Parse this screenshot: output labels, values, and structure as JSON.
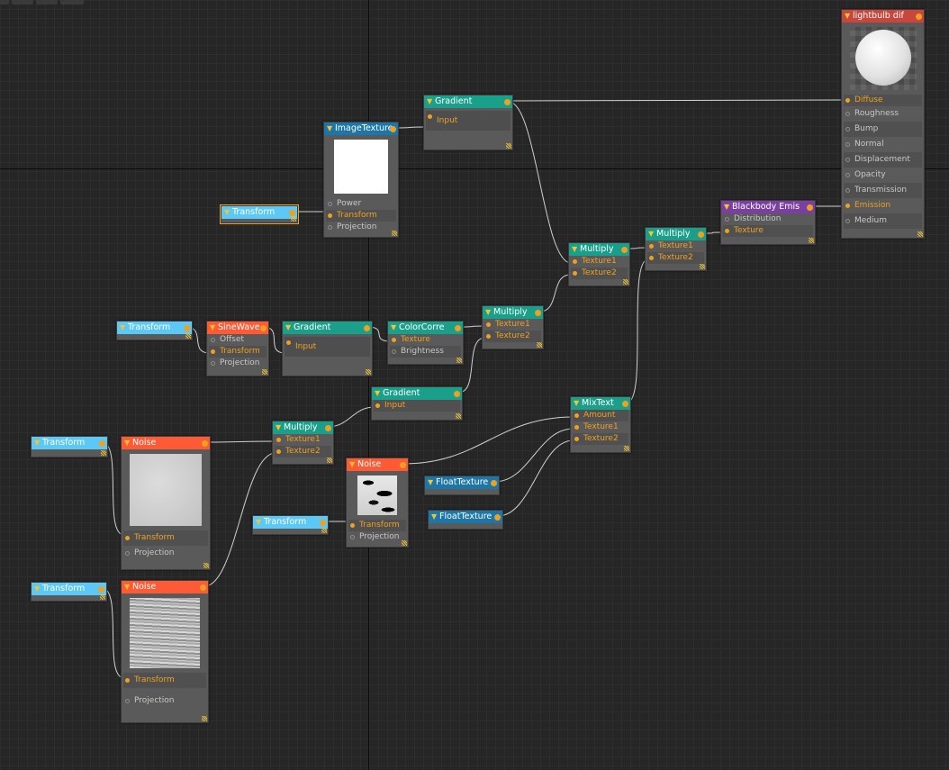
{
  "colors": {
    "transform": "#5bc8f5",
    "noise": "#ff5a36",
    "gradient": "#1aa08a",
    "image_texture": "#1c76a8",
    "float_texture": "#1c76a8",
    "blackbody": "#7a3fa0",
    "material": "#c8463c",
    "wire": "#d0d0d0",
    "pin_active": "#f0a020"
  },
  "nodes": {
    "lightbulb": {
      "title": "lightbulb dif",
      "ports": [
        "Diffuse",
        "Roughness",
        "Bump",
        "Normal",
        "Displacement",
        "Opacity",
        "Transmission",
        "Emission",
        "Medium"
      ]
    },
    "gradient_top": {
      "title": "Gradient",
      "ports": [
        "Input"
      ]
    },
    "image_texture": {
      "title": "ImageTexture",
      "ports": [
        "Power",
        "Transform",
        "Projection"
      ]
    },
    "transform_img": {
      "title": "Transform"
    },
    "blackbody": {
      "title": "Blackbody Emis",
      "ports": [
        "Distribution",
        "Texture"
      ]
    },
    "multiply_a": {
      "title": "Multiply",
      "ports": [
        "Texture1",
        "Texture2"
      ]
    },
    "multiply_b": {
      "title": "Multiply",
      "ports": [
        "Texture1",
        "Texture2"
      ]
    },
    "transform_sine": {
      "title": "Transform"
    },
    "sinewave": {
      "title": "SineWave",
      "ports": [
        "Offset",
        "Transform",
        "Projection"
      ]
    },
    "gradient_mid": {
      "title": "Gradient",
      "ports": [
        "Input"
      ]
    },
    "colorcorrect": {
      "title": "ColorCorre",
      "ports": [
        "Texture",
        "Brightness"
      ]
    },
    "multiply_c": {
      "title": "Multiply",
      "ports": [
        "Texture1",
        "Texture2"
      ]
    },
    "gradient_low": {
      "title": "Gradient",
      "ports": [
        "Input"
      ]
    },
    "mixtext": {
      "title": "MixText",
      "ports": [
        "Amount",
        "Texture1",
        "Texture2"
      ]
    },
    "transform_n1": {
      "title": "Transform"
    },
    "noise_1": {
      "title": "Noise",
      "ports": [
        "Transform",
        "Projection"
      ]
    },
    "multiply_d": {
      "title": "Multiply",
      "ports": [
        "Texture1",
        "Texture2"
      ]
    },
    "noise_2": {
      "title": "Noise",
      "ports": [
        "Transform",
        "Projection"
      ]
    },
    "transform_n2": {
      "title": "Transform"
    },
    "float_1": {
      "title": "FloatTexture"
    },
    "float_2": {
      "title": "FloatTexture"
    },
    "transform_n3": {
      "title": "Transform"
    },
    "noise_3": {
      "title": "Noise",
      "ports": [
        "Transform",
        "Projection"
      ]
    }
  }
}
